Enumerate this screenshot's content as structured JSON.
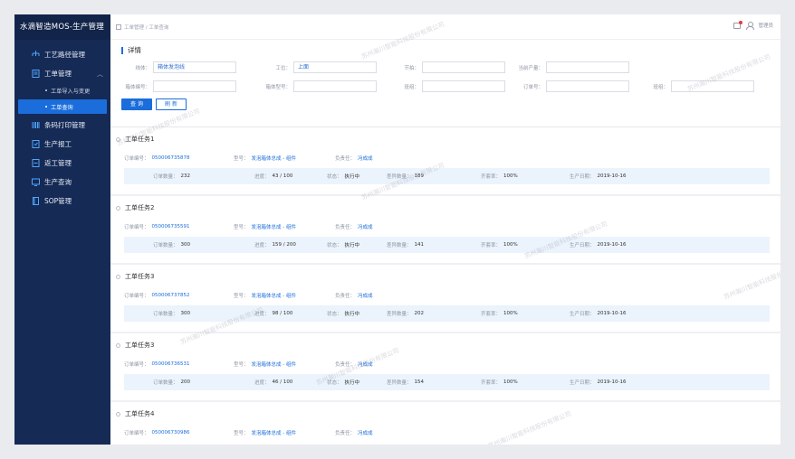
{
  "app": {
    "title": "水滴智造MOS-生产管理"
  },
  "sidebar": {
    "items": [
      {
        "label": "工艺路径管理",
        "icon": "route-icon"
      },
      {
        "label": "工单管理",
        "icon": "document-icon",
        "expanded": true,
        "children": [
          {
            "label": "工单导入与变更",
            "active": false
          },
          {
            "label": "工单查询",
            "active": true
          }
        ]
      },
      {
        "label": "条码打印管理",
        "icon": "barcode-icon"
      },
      {
        "label": "生产报工",
        "icon": "report-icon"
      },
      {
        "label": "返工管理",
        "icon": "rework-icon"
      },
      {
        "label": "生产查询",
        "icon": "monitor-icon"
      },
      {
        "label": "SOP管理",
        "icon": "book-icon"
      }
    ]
  },
  "topbar": {
    "breadcrumb": "工单管理 / 工单查询",
    "user": "管理员"
  },
  "detail": {
    "title": "详情",
    "fields_row1": [
      {
        "label": "线体：",
        "value": "箱体发泡线"
      },
      {
        "label": "工位：",
        "value": "上面"
      },
      {
        "label": "节拍：",
        "value": ""
      },
      {
        "label": "当前产量：",
        "value": ""
      }
    ],
    "fields_row2": [
      {
        "label": "箱体编号：",
        "value": ""
      },
      {
        "label": "箱体型号：",
        "value": ""
      },
      {
        "label": "班组：",
        "value": ""
      },
      {
        "label": "订单号：",
        "value": ""
      },
      {
        "label": "班组：",
        "value": ""
      }
    ],
    "query_label": "查 询",
    "refresh_label": "刷 新"
  },
  "task_labels": {
    "order_no": "订单编号：",
    "model": "型号：",
    "owner": "负责任：",
    "qty": "订单数量：",
    "progress": "进度：",
    "status": "状态：",
    "diff": "差异数量：",
    "rate": "齐套率：",
    "date": "生产日期："
  },
  "tasks": [
    {
      "title": "工单任务1",
      "order_no": "050006735878",
      "model": "发泡箱体总成 - 组件",
      "owner": "冯成成",
      "qty": "232",
      "progress": "43 / 100",
      "status": "执行中",
      "diff": "189",
      "rate": "100%",
      "date": "2019-10-16"
    },
    {
      "title": "工单任务2",
      "order_no": "050006735591",
      "model": "发泡箱体总成 - 组件",
      "owner": "冯成成",
      "qty": "300",
      "progress": "159 / 200",
      "status": "执行中",
      "diff": "141",
      "rate": "100%",
      "date": "2019-10-16"
    },
    {
      "title": "工单任务3",
      "order_no": "050006737852",
      "model": "发泡箱体总成 - 组件",
      "owner": "冯成成",
      "qty": "300",
      "progress": "98 / 100",
      "status": "执行中",
      "diff": "202",
      "rate": "100%",
      "date": "2019-10-16"
    },
    {
      "title": "工单任务3",
      "order_no": "050006736531",
      "model": "发泡箱体总成 - 组件",
      "owner": "冯成成",
      "qty": "200",
      "progress": "46 / 100",
      "status": "执行中",
      "diff": "154",
      "rate": "100%",
      "date": "2019-10-16"
    },
    {
      "title": "工单任务4",
      "order_no": "050006730986",
      "model": "发泡箱体总成 - 组件",
      "owner": "冯成成",
      "qty": "",
      "progress": "",
      "status": "",
      "diff": "",
      "rate": "",
      "date": ""
    }
  ],
  "watermark": "苏州瀚川智能科技股份有限公司"
}
